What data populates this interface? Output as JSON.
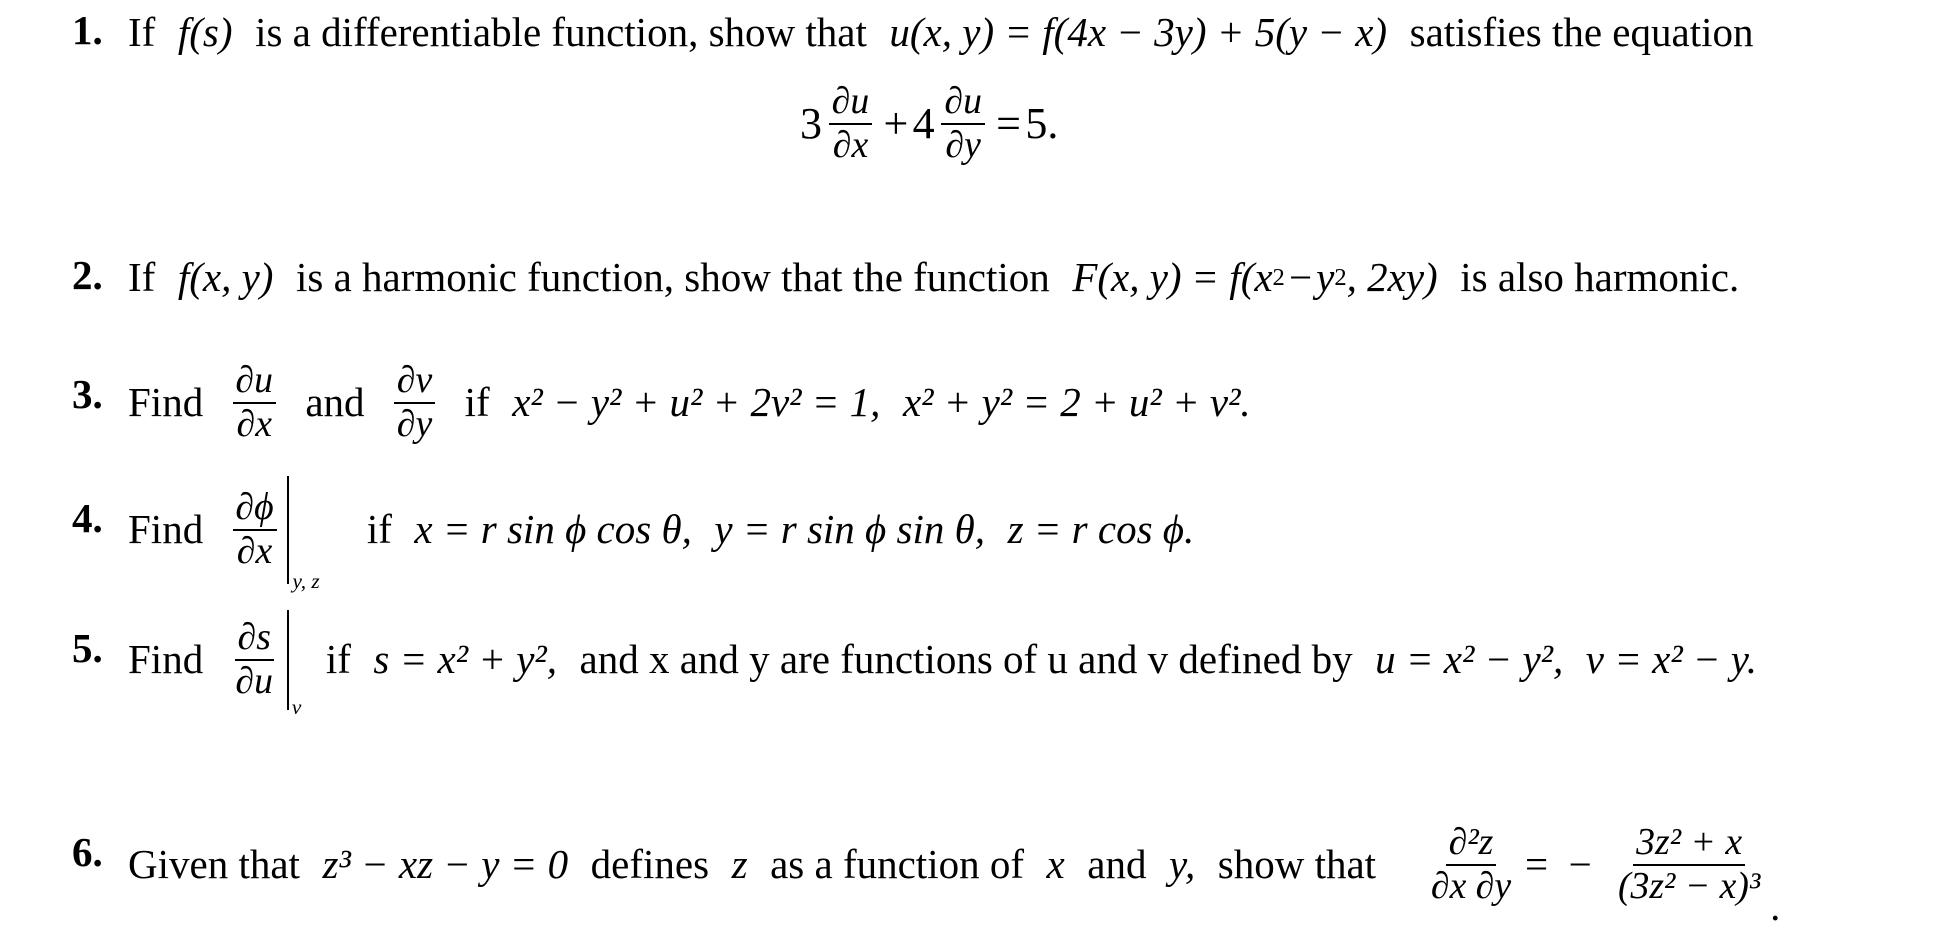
{
  "document": {
    "type": "math-exercise-list",
    "background_color": "#ffffff",
    "text_color": "#000000"
  },
  "problems": [
    {
      "number": "1.",
      "text_before": "If",
      "f_s": "f(s)",
      "text_mid": "is a differentiable function, show that",
      "u_def": "u(x, y) = f(4x − 3y) + 5(y − x)",
      "text_after": "satisfies the equation",
      "display_equation": {
        "coef1": "3",
        "frac1_num": "∂u",
        "frac1_den": "∂x",
        "plus": "+",
        "coef2": "4",
        "frac2_num": "∂u",
        "frac2_den": "∂y",
        "equals": "=",
        "rhs": "5."
      }
    },
    {
      "number": "2.",
      "text_before": "If",
      "f_xy": "f(x, y)",
      "text_mid": "is a harmonic function, show that the function",
      "F_def_lhs": "F(x, y)",
      "equals": "=",
      "F_def_rhs_open": "f(x",
      "F_def_sup1": "2",
      "F_def_minus": "−",
      "F_def_y": "y",
      "F_def_sup2": "2",
      "F_def_comma": ", 2xy)",
      "text_after": "is also harmonic."
    },
    {
      "number": "3.",
      "find": "Find",
      "frac1_num": "∂u",
      "frac1_den": "∂x",
      "and": "and",
      "frac2_num": "∂v",
      "frac2_den": "∂y",
      "if": "if",
      "eq1": "x² − y² + u² + 2v² = 1,",
      "eq2": "x² + y² = 2 + u² + v²."
    },
    {
      "number": "4.",
      "find": "Find",
      "frac_num": "∂ϕ",
      "frac_den": "∂x",
      "eval_sub": "y, z",
      "if": "if",
      "eq_x": "x = r sin ϕ cos θ,",
      "eq_y": "y = r sin ϕ sin θ,",
      "eq_z": "z = r cos ϕ."
    },
    {
      "number": "5.",
      "find": "Find",
      "frac_num": "∂s",
      "frac_den": "∂u",
      "eval_sub": "v",
      "if": "if",
      "s_def": "s = x² + y²,",
      "text_mid": "and x and y are functions of u and v defined by",
      "u_def": "u = x² − y²,",
      "v_def": "v = x² − y."
    },
    {
      "number": "6.",
      "given_that": "Given that",
      "relation": "z³ − xz − y = 0",
      "defines": "defines",
      "z": "z",
      "text_mid": "as a function of",
      "x": "x",
      "and": "and",
      "y": "y,",
      "show_that": "show that",
      "lhs_num": "∂²z",
      "lhs_den": "∂x ∂y",
      "equals": "=",
      "minus": "−",
      "rhs_num": "3z² + x",
      "rhs_den": "(3z² − x)³",
      "period": "."
    }
  ]
}
